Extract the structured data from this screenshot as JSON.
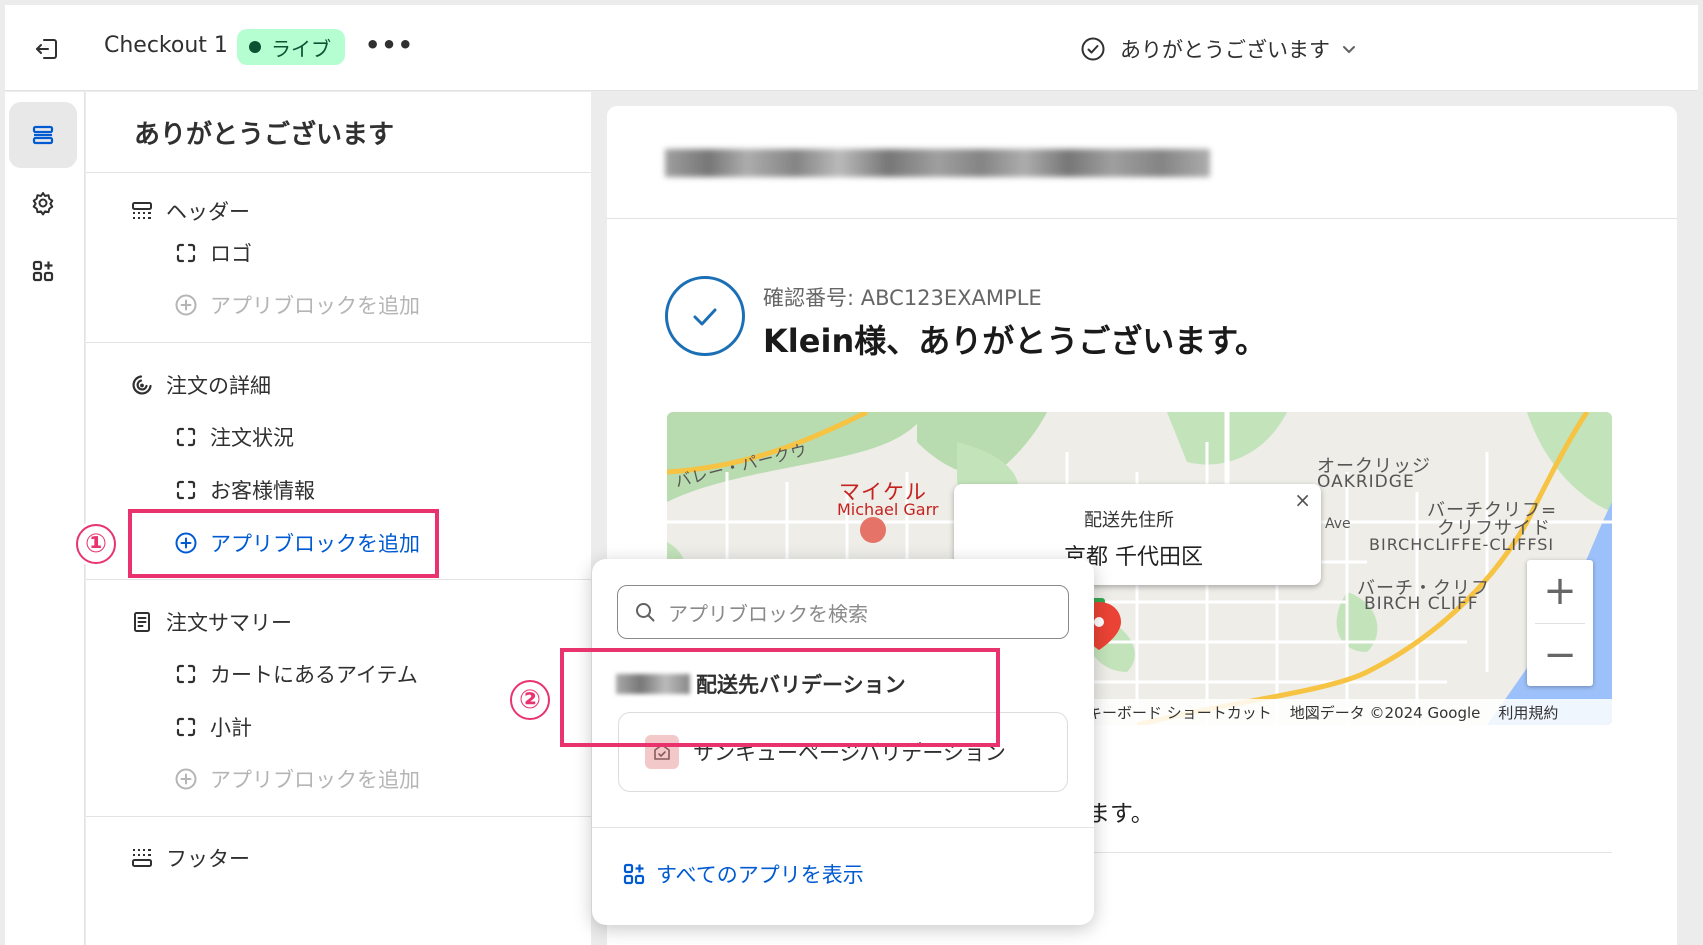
{
  "topbar": {
    "checkout_name": "Checkout 1",
    "status_badge": "ライブ",
    "more_label": "•••",
    "page_selector": "ありがとうございます"
  },
  "sidebar": {
    "title": "ありがとうございます",
    "sections": {
      "header": {
        "label": "ヘッダー",
        "logo": "ロゴ",
        "add_block": "アプリブロックを追加"
      },
      "order_details": {
        "label": "注文の詳細",
        "order_status": "注文状況",
        "customer_info": "お客様情報",
        "add_block": "アプリブロックを追加"
      },
      "order_summary": {
        "label": "注文サマリー",
        "cart_items": "カートにあるアイテム",
        "subtotal": "小計",
        "add_block": "アプリブロックを追加"
      },
      "footer": {
        "label": "フッター"
      }
    }
  },
  "annotations": {
    "step1": "①",
    "step2": "②"
  },
  "preview": {
    "confirmation_number": "確認番号: ABC123EXAMPLE",
    "thank_you": "Klein様、ありがとうございます。",
    "delivery_text": "届きます。",
    "map": {
      "popup_title": "配送先住所",
      "popup_address": "京都 千代田区",
      "close": "×",
      "zoom_in": "+",
      "zoom_out": "−",
      "labels": {
        "valley": "バレー・パークウ",
        "michael_jp": "マイケル",
        "michael_en": "Michael Garr",
        "oakridge_jp": "オークリッジ",
        "oakridge_en": "OAKRIDGE",
        "birchcliffe_jp": "バーチクリフ=",
        "birchcliffe_jp2": "クリフサイド",
        "birchcliffe_en": "BIRCHCLIFFE-CLIFFSI",
        "birch_jp": "バーチ・クリフ",
        "birch_en": "BIRCH CLIFF",
        "ave": "Ave"
      },
      "footer": {
        "shortcuts": "キーボード ショートカット",
        "map_data": "地図データ ©2024 Google",
        "terms": "利用規約"
      }
    }
  },
  "popover": {
    "search_placeholder": "アプリブロックを検索",
    "group_name": "配送先バリデーション",
    "app_item": "サンキューページバリデーション",
    "view_all": "すべてのアプリを表示"
  },
  "colors": {
    "accent_blue": "#005bd3",
    "annotation_pink": "#e8336f",
    "live_badge_bg": "#b4fed2",
    "check_blue": "#1b6fb5"
  }
}
